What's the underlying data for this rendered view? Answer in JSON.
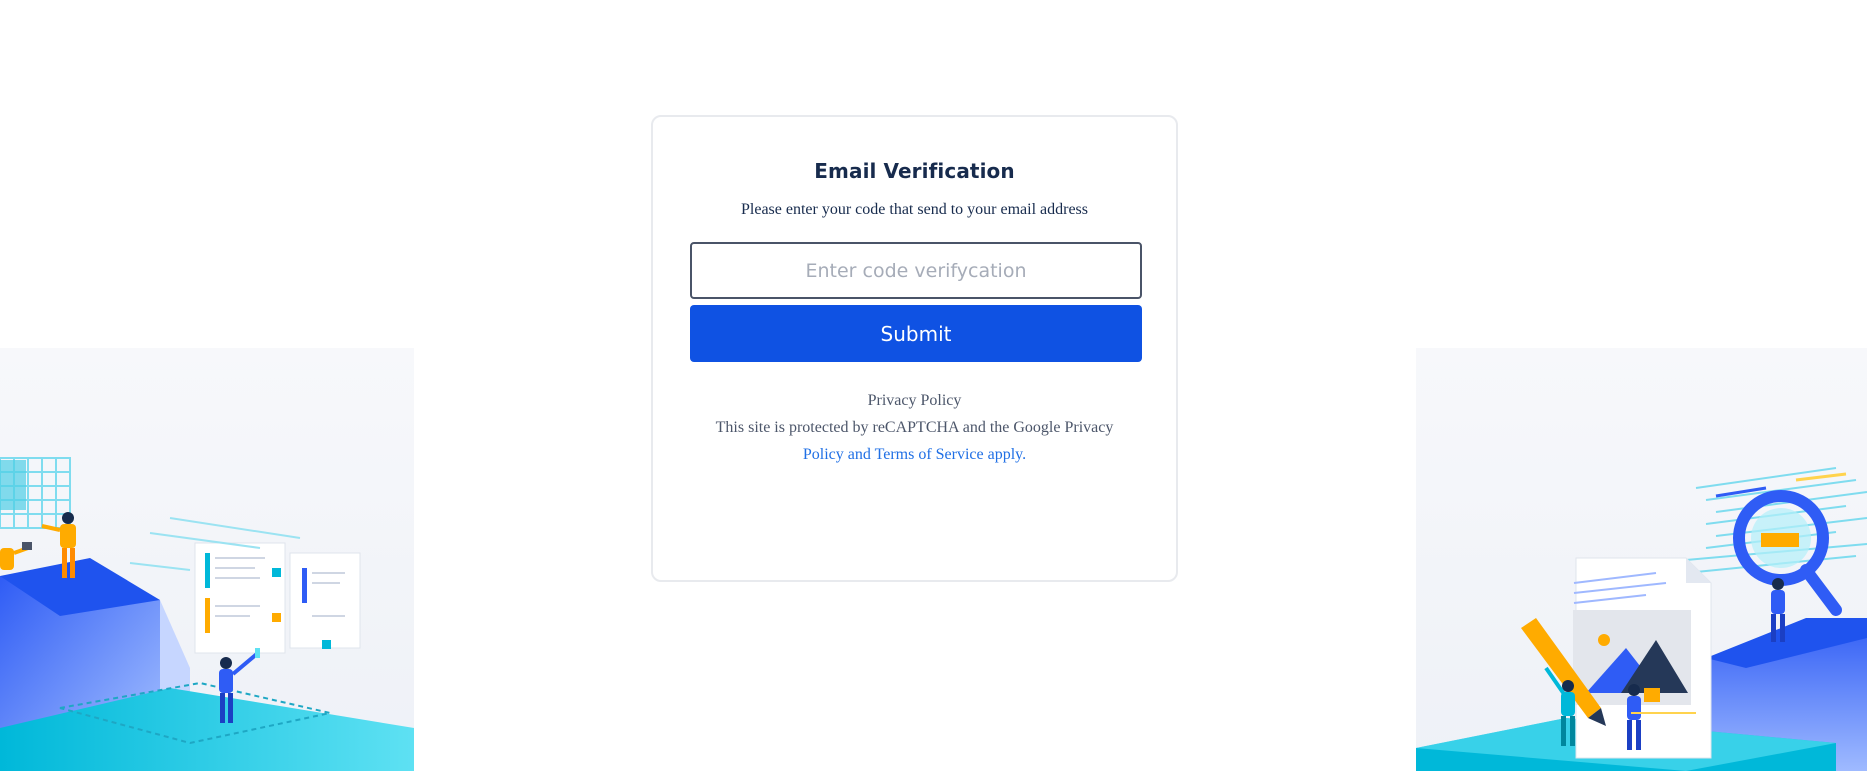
{
  "card": {
    "title": "Email Verification",
    "subtitle": "Please enter your code that send to your email address",
    "code_input": {
      "value": "",
      "placeholder": "Enter code verifycation"
    },
    "submit_label": "Submit"
  },
  "legal": {
    "privacy_policy": "Privacy Policy",
    "recaptcha_text": "This site is protected by reCAPTCHA and the Google Privacy",
    "policy_and": "Policy and",
    "terms_link": "Terms of Service",
    "apply": "apply."
  },
  "colors": {
    "primary": "#0f52e3",
    "link": "#1f6fe5",
    "text": "#172b4d",
    "accent_cyan": "#00b8d9",
    "accent_orange": "#ffab00"
  },
  "icons": {
    "left_illustration": "team-collaboration-illustration",
    "right_illustration": "search-document-illustration"
  }
}
